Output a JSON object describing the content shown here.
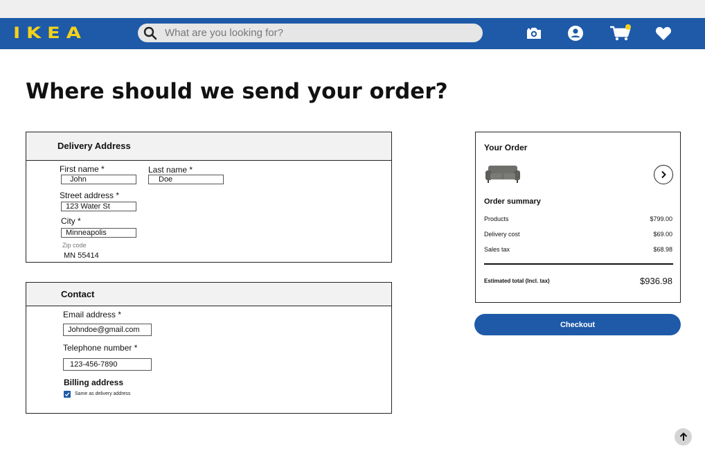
{
  "header": {
    "brand": "IKEA",
    "brand_color": "#f5d21a",
    "nav_color": "#1e5aa8",
    "search": {
      "placeholder": "What are you looking for?",
      "value": ""
    },
    "icons": [
      "camera-icon",
      "account-icon",
      "cart-icon",
      "heart-icon"
    ],
    "cart_badge": "1"
  },
  "page": {
    "title": "Where should we send your order?"
  },
  "delivery": {
    "heading": "Delivery Address",
    "first_name_label": "First name *",
    "first_name_value": "John",
    "last_name_label": "Last name *",
    "last_name_value": "Doe",
    "street_label": "Street address *",
    "street_value": "123 Water St",
    "city_label": "City *",
    "city_value": "Minneapolis",
    "zip_label": "Zip code",
    "zip_value": "MN 55414"
  },
  "contact": {
    "heading": "Contact",
    "email_label": "Email address *",
    "email_value": "Johndoe@gmail.com",
    "phone_label": "Telephone number *",
    "phone_value": "123-456-7890",
    "billing_heading": "Billing address",
    "same_as_delivery_label": "Same as delivery address",
    "same_as_delivery_checked": true
  },
  "order": {
    "heading": "Your Order",
    "product_icon": "sofa-image",
    "summary_heading": "Order summary",
    "rows": [
      {
        "label": "Products",
        "value": "$799.00"
      },
      {
        "label": "Delivery cost",
        "value": "$69.00"
      },
      {
        "label": "Sales tax",
        "value": "$68.98"
      }
    ],
    "total_label": "Estimated total (Incl. tax)",
    "total_value": "$936.98"
  },
  "actions": {
    "checkout_label": "Checkout"
  }
}
